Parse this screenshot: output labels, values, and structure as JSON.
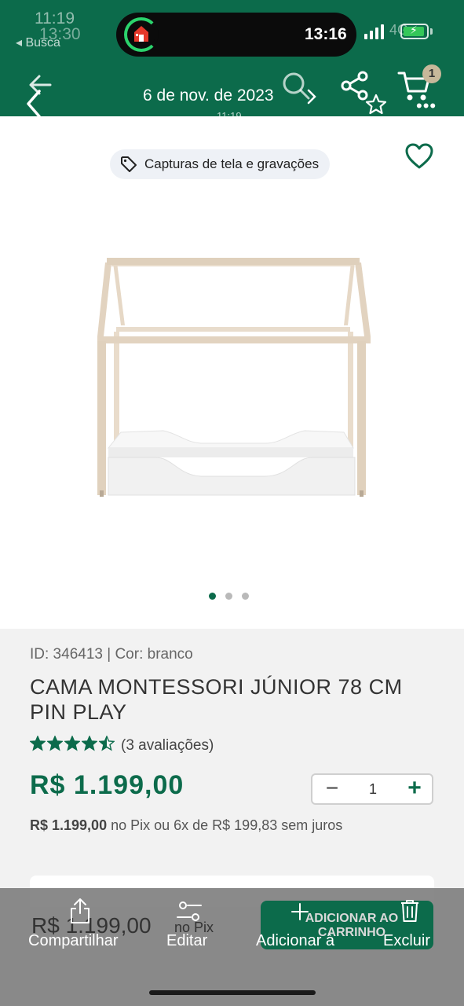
{
  "status": {
    "ghost_time_1": "11:19",
    "ghost_time_2": "13:30",
    "back_app": "◂ Busca",
    "time": "13:16",
    "network_ghost": "4G"
  },
  "nav": {
    "date_title": "6 de nov. de 2023",
    "time_sub": "11:19",
    "cart_count": "1"
  },
  "media": {
    "chip_label": "Capturas de tela e gravações",
    "carousel_count": 3,
    "carousel_active": 0
  },
  "product": {
    "meta": "ID: 346413 | Cor: branco",
    "name": "CAMA MONTESSORI JÚNIOR 78 CM PIN PLAY",
    "rating": 4.5,
    "reviews": "(3 avaliações)",
    "price": "R$ 1.199,00",
    "quantity": "1",
    "pix_price": "R$ 1.199,00",
    "pix_text": " no Pix ou 6x de R$ 199,83 sem juros"
  },
  "bottom_bar": {
    "price": "R$ 1.199,00",
    "no_pix": "no Pix",
    "add_to_cart": "ADICIONAR AO CARRINHO",
    "share_label": "Compartilhar",
    "edit_label": "Editar",
    "add_label": "Adicionar à",
    "delete_label": "Excluir"
  },
  "colors": {
    "brand_green": "#0c6b4b",
    "star": "#0c6b4b",
    "bed_wood": "#e2d3c0",
    "bed_white": "#f2f2f2"
  }
}
